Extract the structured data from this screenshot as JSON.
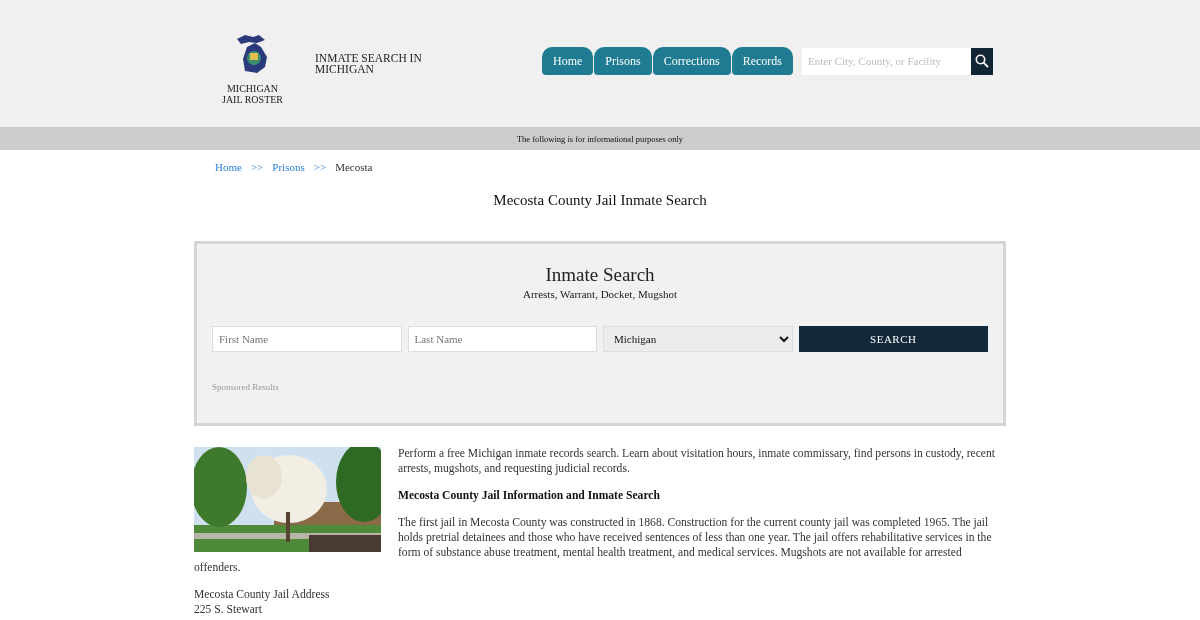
{
  "logo": {
    "line_1": "MICHIGAN",
    "line_2": "JAIL ROSTER"
  },
  "site_title": "INMATE SEARCH IN MICHIGAN",
  "nav": [
    {
      "label": "Home"
    },
    {
      "label": "Prisons"
    },
    {
      "label": "Corrections"
    },
    {
      "label": "Records"
    }
  ],
  "site_search": {
    "placeholder": "Enter City, County, or Facility"
  },
  "notice": "The following is for informational purposes only",
  "breadcrumb": [
    {
      "label": "Home",
      "link": true
    },
    {
      "label": "Prisons",
      "link": true
    },
    {
      "label": "Mecosta",
      "link": false
    }
  ],
  "breadcrumb_separator": ">>",
  "page_title": "Mecosta County Jail Inmate Search",
  "search_panel": {
    "title": "Inmate Search",
    "subtitle": "Arrests, Warrant, Docket, Mugshot",
    "fields": [
      {
        "placeholder": "First Name"
      },
      {
        "placeholder": "Last Name"
      }
    ],
    "state_select": "Michigan",
    "button": "SEARCH",
    "sponsored": "Sponsored Results"
  },
  "article": {
    "image": {
      "kind": "picture"
    },
    "paragraphs": [
      {
        "kind": "text",
        "text": "Perform a free Michigan inmate records search. Learn about visitation hours, inmate commissary, find persons in custody, recent arrests, mugshots, and requesting judicial records."
      },
      {
        "kind": "heading",
        "text": "Mecosta County Jail Information and Inmate Search"
      },
      {
        "kind": "text",
        "text": "The first jail in Mecosta County was constructed in 1868. Construction for the current county jail was completed 1965. The jail holds pretrial detainees and those who have received sentences of less than one year. The jail offers rehabilitative services in the form of substance abuse treatment, mental health treatment, and medical services. Mugshots are not available for arrested offenders."
      }
    ],
    "address": [
      "Mecosta County Jail Address",
      "225 S. Stewart"
    ]
  }
}
